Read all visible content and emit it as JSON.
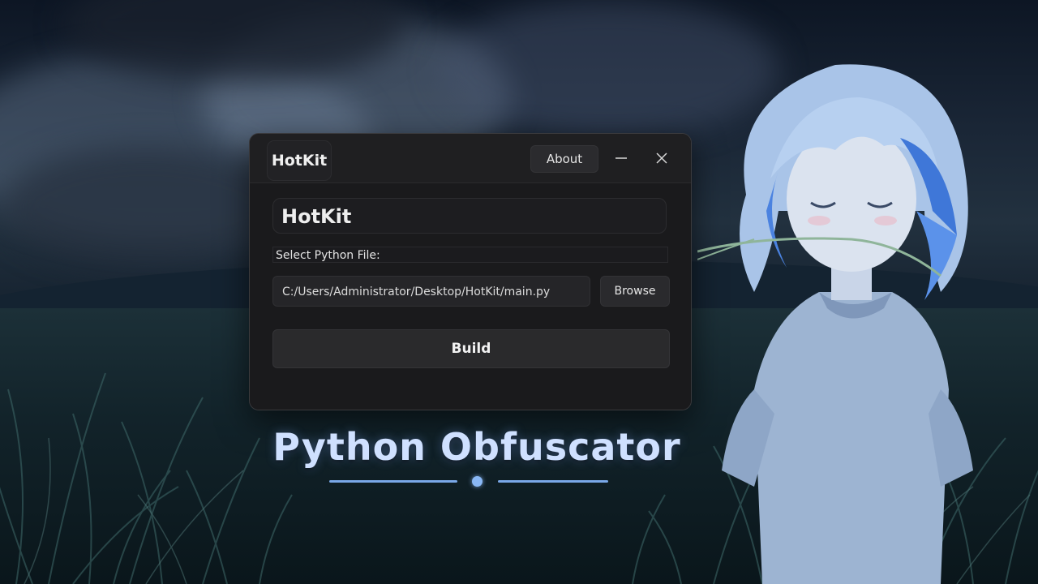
{
  "window": {
    "brand": "HotKit",
    "about_label": "About",
    "minimize_icon": "minimize-icon",
    "close_icon": "close-icon"
  },
  "content": {
    "app_title": "HotKit",
    "select_label": "Select Python File:",
    "file_path": "C:/Users/Administrator/Desktop/HotKit/main.py",
    "browse_label": "Browse",
    "build_label": "Build"
  },
  "caption": {
    "title": "Python Obfuscator"
  },
  "colors": {
    "window_bg": "#1c1c1e",
    "caption_text": "#cfe0ff",
    "accent_line": "#7aa8e8"
  }
}
